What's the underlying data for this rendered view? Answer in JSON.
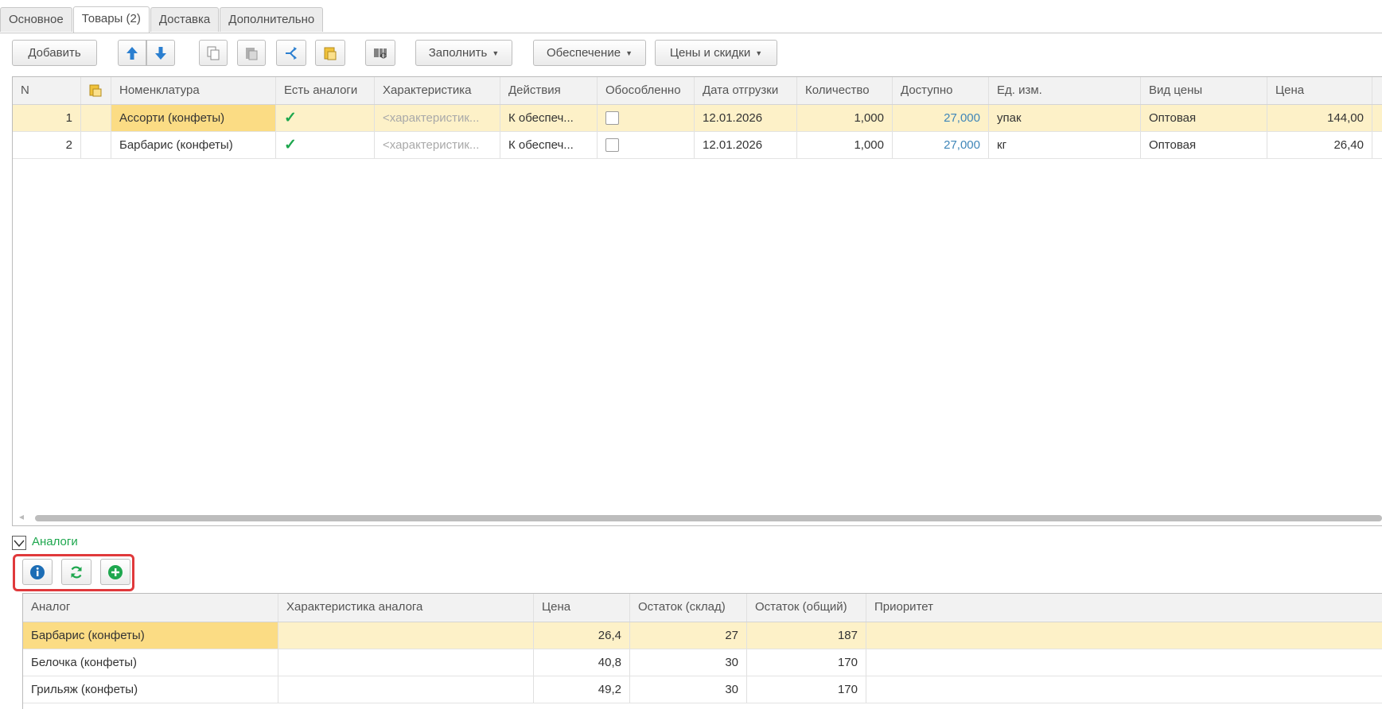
{
  "tabs": [
    {
      "label": "Основное"
    },
    {
      "label": "Товары (2)"
    },
    {
      "label": "Доставка"
    },
    {
      "label": "Дополнительно"
    }
  ],
  "toolbar": {
    "add_label": "Добавить",
    "fill_label": "Заполнить",
    "supply_label": "Обеспечение",
    "prices_label": "Цены и скидки"
  },
  "goods": {
    "columns": [
      "N",
      "",
      "Номенклатура",
      "Есть аналоги",
      "Характеристика",
      "Действия",
      "Обособленно",
      "Дата отгрузки",
      "Количество",
      "Доступно",
      "Ед. изм.",
      "Вид цены",
      "Цена"
    ],
    "rows": [
      {
        "n": "1",
        "name": "Ассорти (конфеты)",
        "has_analogs": "✓",
        "characteristic": "<характеристик...",
        "action": "К обеспеч...",
        "date": "12.01.2026",
        "qty": "1,000",
        "available": "27,000",
        "unit": "упак",
        "price_type": "Оптовая",
        "price": "144,00"
      },
      {
        "n": "2",
        "name": "Барбарис (конфеты)",
        "has_analogs": "✓",
        "characteristic": "<характеристик...",
        "action": "К обеспеч...",
        "date": "12.01.2026",
        "qty": "1,000",
        "available": "27,000",
        "unit": "кг",
        "price_type": "Оптовая",
        "price": "26,40"
      }
    ]
  },
  "analogs": {
    "title": "Аналоги",
    "columns": [
      "Аналог",
      "Характеристика аналога",
      "Цена",
      "Остаток (склад)",
      "Остаток (общий)",
      "Приоритет"
    ],
    "rows": [
      {
        "name": "Барбарис (конфеты)",
        "characteristic": "",
        "price": "26,4",
        "stock_wh": "27",
        "stock_total": "187",
        "priority": ""
      },
      {
        "name": "Белочка (конфеты)",
        "characteristic": "",
        "price": "40,8",
        "stock_wh": "30",
        "stock_total": "170",
        "priority": ""
      },
      {
        "name": "Грильяж (конфеты)",
        "characteristic": "",
        "price": "49,2",
        "stock_wh": "30",
        "stock_total": "170",
        "priority": ""
      }
    ]
  },
  "colors": {
    "accent_green": "#1ea74e",
    "selected_row": "#fdf1c8",
    "selected_cell": "#fbdc84",
    "highlight_frame": "#e0393b"
  }
}
